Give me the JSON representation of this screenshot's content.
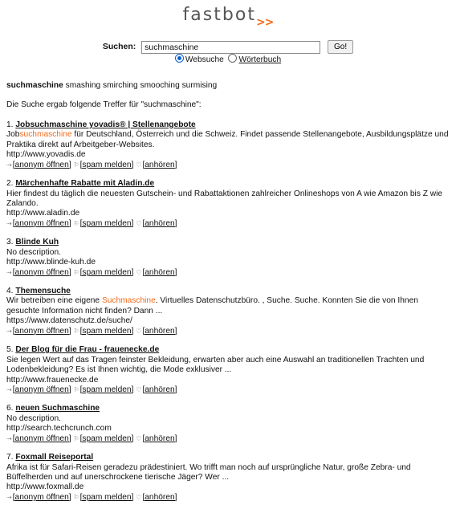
{
  "logo": {
    "part1": "fast",
    "part2": "bot",
    "arrows": ">>"
  },
  "search": {
    "label": "Suchen:",
    "value": "suchmaschine",
    "button": "Go!"
  },
  "modes": {
    "web": "Websuche",
    "dict": "Wörterbuch",
    "selected": "web"
  },
  "suggestions": {
    "term": "suchmaschine",
    "rest": "smashing smirching smooching surmising"
  },
  "intro": "Die Suche ergab folgende Treffer für \"suchmaschine\":",
  "actions": {
    "open": "[anonym öffnen]",
    "spam": "[spam melden]",
    "listen": "[anhören]"
  },
  "results": [
    {
      "num": "1.",
      "title": "Jobsuchmaschine yovadis® | Stellenangebote",
      "desc_pre": "Job",
      "desc_hl": "suchmaschine",
      "desc_post": " für Deutschland, Österreich und die Schweiz. Findet passende Stellenangebote, Ausbildungsplätze und Praktika direkt auf Arbeitgeber-Websites.",
      "url": "http://www.yovadis.de"
    },
    {
      "num": "2.",
      "title": "Märchenhafte Rabatte mit Aladin.de",
      "desc_pre": "Hier findest du täglich die neuesten Gutschein- und Rabattaktionen zahlreicher Onlineshops von A wie Amazon bis Z wie Zalando.",
      "desc_hl": "",
      "desc_post": "",
      "url": "http://www.aladin.de"
    },
    {
      "num": "3.",
      "title": "Blinde Kuh",
      "desc_pre": "No description.",
      "desc_hl": "",
      "desc_post": "",
      "url": "http://www.blinde-kuh.de"
    },
    {
      "num": "4.",
      "title": "Themensuche",
      "desc_pre": "Wir betreiben eine eigene ",
      "desc_hl": "Suchmaschine",
      "desc_post": ". Virtuelles Datenschutzbüro. , Suche. Suche. Konnten Sie die von Ihnen gesuchte Information nicht finden? Dann ...",
      "url": "https://www.datenschutz.de/suche/"
    },
    {
      "num": "5.",
      "title": "Der Blog für die Frau - frauenecke.de",
      "desc_pre": "Sie legen Wert auf das Tragen feinster Bekleidung, erwarten aber auch eine Auswahl an traditionellen Trachten und Lodenbekleidung? Es ist Ihnen wichtig, die Mode exklusiver ...",
      "desc_hl": "",
      "desc_post": "",
      "url": "http://www.frauenecke.de"
    },
    {
      "num": "6.",
      "title": "neuen Suchmaschine",
      "desc_pre": "No description.",
      "desc_hl": "",
      "desc_post": "",
      "url": "http://search.techcrunch.com"
    },
    {
      "num": "7.",
      "title": "Foxmall Reiseportal",
      "desc_pre": "Afrika ist für Safari-Reisen geradezu prädestiniert. Wo trifft man noch auf ursprüngliche Natur, große Zebra- und Büffelherden und auf unerschrockene tierische Jäger? Wer ...",
      "desc_hl": "",
      "desc_post": "",
      "url": "http://www.foxmall.de"
    }
  ]
}
